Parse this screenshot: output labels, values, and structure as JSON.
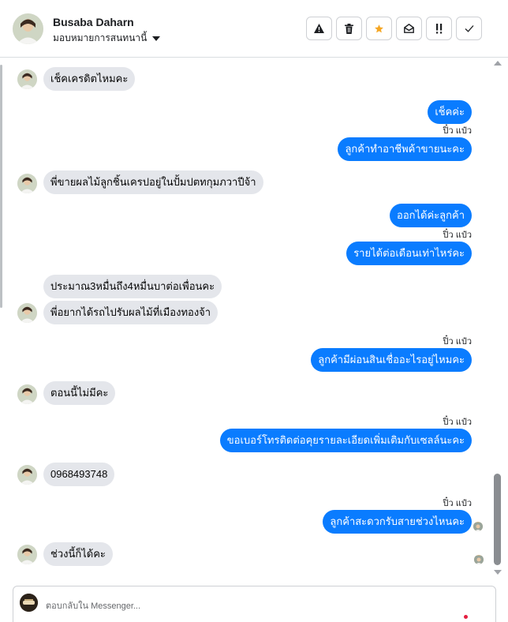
{
  "header": {
    "name": "Busaba Daharn",
    "assign_label": "มอบหมายการสนทนานี้",
    "toolbar": [
      {
        "name": "warning-icon",
        "glyph": "▲"
      },
      {
        "name": "trash-icon",
        "glyph": "🗑"
      },
      {
        "name": "star-icon",
        "glyph": "★"
      },
      {
        "name": "mark-unread-icon",
        "glyph": "✉"
      },
      {
        "name": "priority-icon",
        "glyph": "!!"
      },
      {
        "name": "done-icon",
        "glyph": "✓"
      }
    ]
  },
  "messages": [
    {
      "side": "in",
      "text": "เช็คเครดิตไหมคะ"
    },
    {
      "side": "out",
      "text": "เช็คค่ะ"
    },
    {
      "side": "sender",
      "text": "ปิ๋ว แป๋ว"
    },
    {
      "side": "out",
      "text": "ลูกค้าทำอาชีพค้าขายนะคะ"
    },
    {
      "side": "in",
      "text": "พี่ขายผลไม้ลูกชิ้นเครปอยู่ในปั้มปตทกุมภวาปีจ้า"
    },
    {
      "side": "out",
      "text": "ออกได้ค่ะลูกค้า"
    },
    {
      "side": "sender",
      "text": "ปิ๋ว แป๋ว"
    },
    {
      "side": "out",
      "text": "รายได้ต่อเดือนเท่าไหร่คะ"
    },
    {
      "side": "in",
      "text": "ประมาณ3หมื่นถึง4หมื่นบาต่อเพื่อนคะ"
    },
    {
      "side": "in",
      "text": "พี่อยากได้รถไปรับผลไม้ที่เมืองทองจ้า"
    },
    {
      "side": "sender",
      "text": "ปิ๋ว แป๋ว"
    },
    {
      "side": "out",
      "text": "ลูกค้ามีผ่อนสินเชื่ออะไรอยู่ไหมคะ"
    },
    {
      "side": "in",
      "text": "ตอนนี้ไม่มีคะ"
    },
    {
      "side": "sender",
      "text": "ปิ๋ว แป๋ว"
    },
    {
      "side": "out",
      "text": "ขอเบอร์โทรติดต่อคุยรายละเอียดเพิ่มเติมกับเซลล์นะคะ"
    },
    {
      "side": "in",
      "text": "0968493748"
    },
    {
      "side": "sender",
      "text": "ปิ๋ว แป๋ว"
    },
    {
      "side": "out",
      "text": "ลูกค้าสะดวกรับสายช่วงไหนคะ"
    },
    {
      "side": "in",
      "text": "ช่วงนี้ก็ได้คะ"
    }
  ],
  "composer": {
    "placeholder": "ตอบกลับใน Messenger..."
  },
  "colors": {
    "outgoing_bubble": "#0a7cff",
    "incoming_bubble": "#e4e6eb",
    "star": "#f5a623"
  }
}
